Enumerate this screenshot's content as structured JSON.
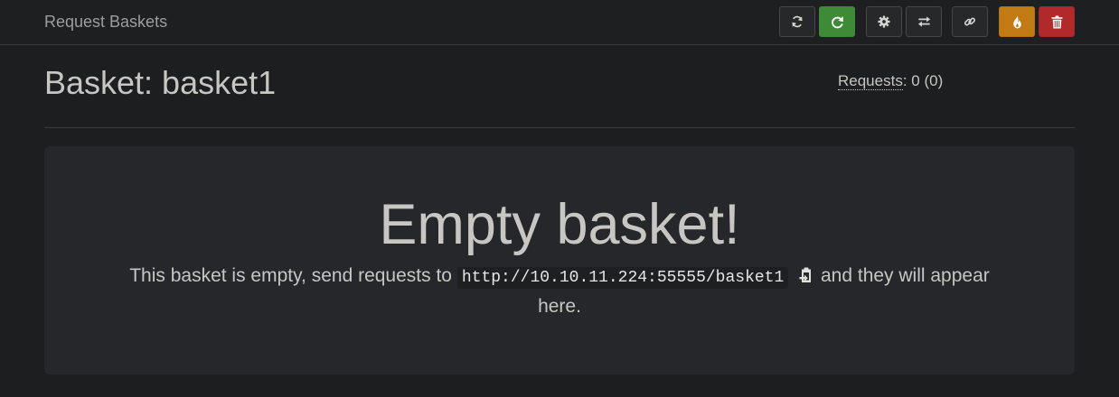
{
  "navbar": {
    "brand": "Request Baskets"
  },
  "toolbar": {
    "buttons": [
      {
        "name": "refresh-button",
        "icon": "refresh-icon",
        "style": "default"
      },
      {
        "name": "auto-refresh-button",
        "icon": "redo-icon",
        "style": "success"
      },
      {
        "name": "settings-button",
        "icon": "gear-icon",
        "style": "default"
      },
      {
        "name": "responses-button",
        "icon": "transfer-icon",
        "style": "default"
      },
      {
        "name": "share-button",
        "icon": "link-icon",
        "style": "default"
      },
      {
        "name": "clear-button",
        "icon": "fire-icon",
        "style": "warning"
      },
      {
        "name": "delete-button",
        "icon": "trash-icon",
        "style": "danger"
      }
    ]
  },
  "basket": {
    "title": "Basket: basket1",
    "requests_label": "Requests",
    "requests_count": ": 0 (0)"
  },
  "empty": {
    "heading": "Empty basket!",
    "text_before": "This basket is empty, send requests to",
    "url": "http://10.10.11.224:55555/basket1",
    "text_after": "and they will appear here."
  },
  "colors": {
    "background": "#1d1e20",
    "panel": "#26272a",
    "success": "#3d8b37",
    "warning": "#c27a14",
    "danger": "#b02a2a"
  }
}
